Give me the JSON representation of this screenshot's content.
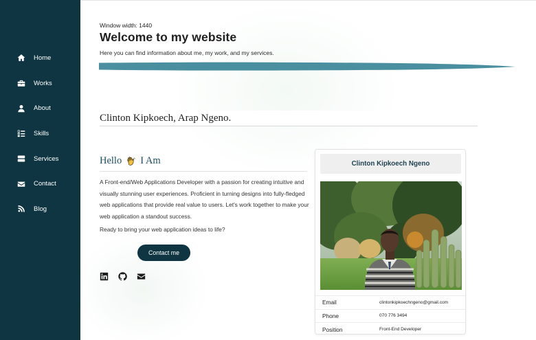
{
  "sidebar": {
    "items": [
      {
        "label": "Home",
        "icon": "home-icon"
      },
      {
        "label": "Works",
        "icon": "briefcase-icon"
      },
      {
        "label": "About",
        "icon": "user-icon"
      },
      {
        "label": "Skills",
        "icon": "tasks-icon"
      },
      {
        "label": "Services",
        "icon": "server-icon"
      },
      {
        "label": "Contact",
        "icon": "envelope-icon"
      },
      {
        "label": "Blog",
        "icon": "blog-icon"
      }
    ]
  },
  "header": {
    "window_width": "Window width: 1440",
    "title": "Welcome to my website",
    "subtitle": "Here you can find information about me, my work, and my services."
  },
  "about": {
    "name": "Clinton Kipkoech, Arap Ngeno.",
    "hello": "Hello",
    "i_am": "I Am",
    "bio": "A Front-end/Web Applications Developer with a passion for creating intuitive and visually stunning user experiences. Proficient in turning designs into fully-fledged web applications that provide real value to users. Let's work together to make your web application a standout success.",
    "cta_text": "Ready to bring your web application ideas to life?",
    "contact_button": "Contact me",
    "socials": [
      "linkedin-icon",
      "github-icon",
      "envelope-icon"
    ]
  },
  "profile_card": {
    "name": "Clinton Kipkoech Ngeno",
    "rows": [
      {
        "label": "Email",
        "value": "clintonkipkoechngeno@gmail.com"
      },
      {
        "label": "Phone",
        "value": "070 776 3494"
      },
      {
        "label": "Position",
        "value": "Front-End Developer"
      }
    ]
  },
  "colors": {
    "sidebar_bg": "#0e3541",
    "accent_stroke": "#4a8f9f",
    "hello_text": "#1d4f63",
    "button_bg": "#0e3541"
  }
}
